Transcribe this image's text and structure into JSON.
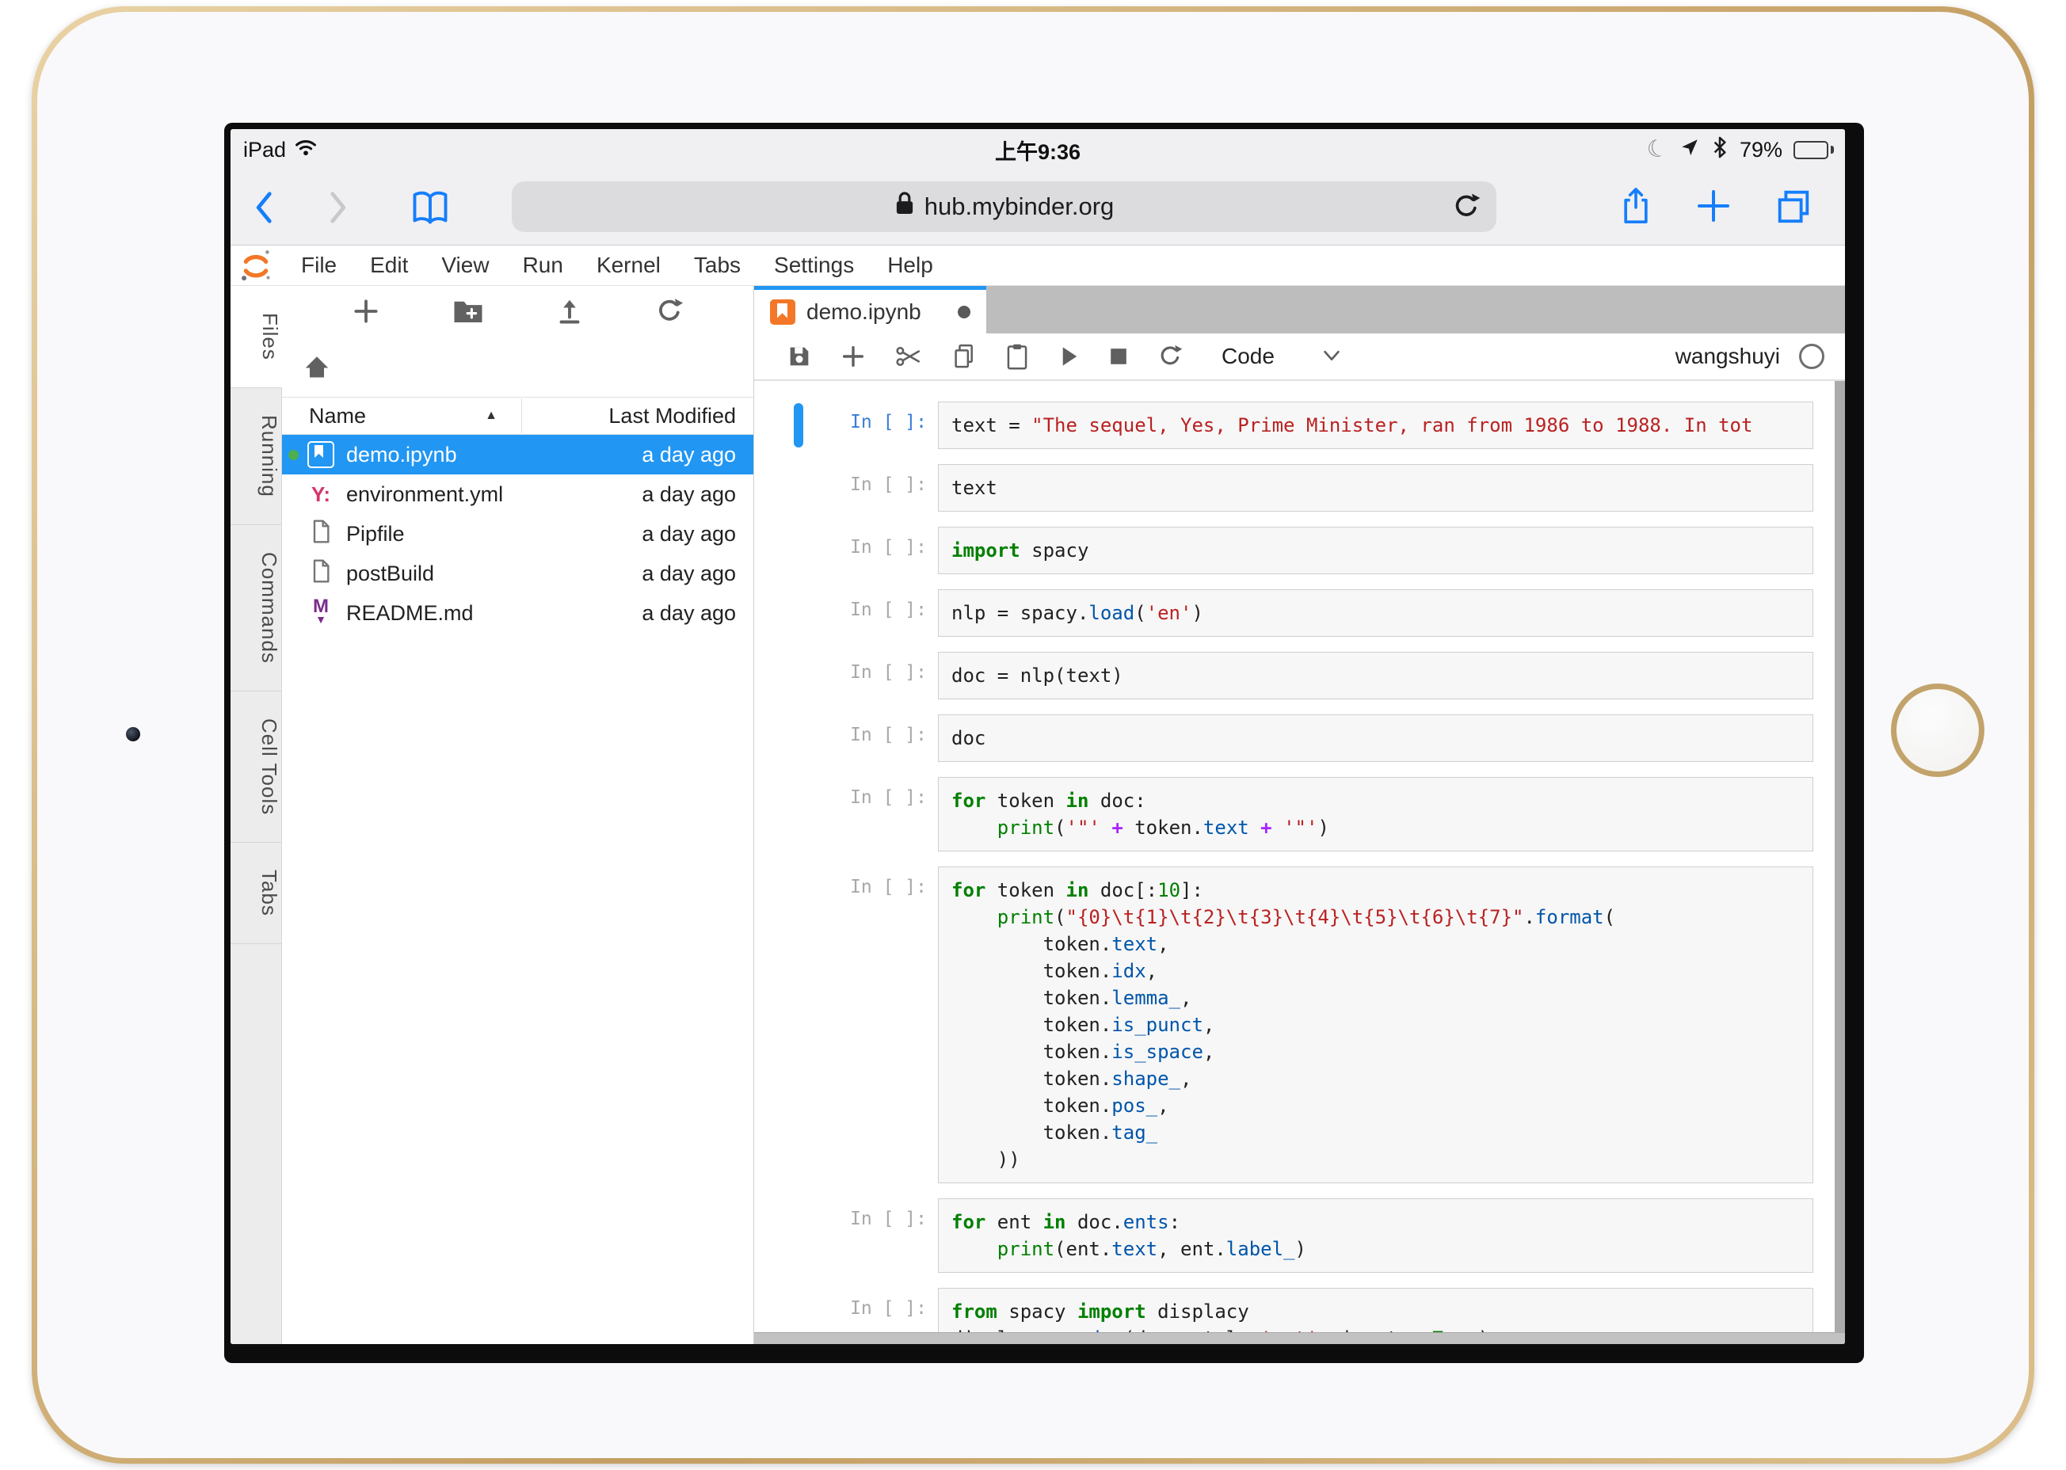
{
  "status_bar": {
    "carrier": "iPad",
    "time": "上午9:36",
    "battery_percent": "79%"
  },
  "browser": {
    "url": "hub.mybinder.org"
  },
  "menu_bar": {
    "items": [
      "File",
      "Edit",
      "View",
      "Run",
      "Kernel",
      "Tabs",
      "Settings",
      "Help"
    ]
  },
  "sidebar": {
    "tabs": [
      "Files",
      "Running",
      "Commands",
      "Cell Tools",
      "Tabs"
    ],
    "active": "Files"
  },
  "file_browser": {
    "columns": {
      "name": "Name",
      "modified": "Last Modified"
    },
    "files": [
      {
        "name": "demo.ipynb",
        "modified": "a day ago",
        "icon": "notebook-icon",
        "selected": true,
        "running": true
      },
      {
        "name": "environment.yml",
        "modified": "a day ago",
        "icon": "yaml-icon",
        "selected": false,
        "running": false
      },
      {
        "name": "Pipfile",
        "modified": "a day ago",
        "icon": "file-icon",
        "selected": false,
        "running": false
      },
      {
        "name": "postBuild",
        "modified": "a day ago",
        "icon": "file-icon",
        "selected": false,
        "running": false
      },
      {
        "name": "README.md",
        "modified": "a day ago",
        "icon": "markdown-icon",
        "selected": false,
        "running": false
      }
    ]
  },
  "notebook": {
    "tab_title": "demo.ipynb",
    "dirty": true,
    "cell_type": "Code",
    "user": "wangshuyi",
    "cells": [
      {
        "prompt": "In [ ]:",
        "active": true,
        "lines": [
          [
            [
              "t",
              "text = "
            ],
            [
              "s",
              "\"The sequel, Yes, Prime Minister, ran from 1986 to 1988. In tot"
            ]
          ]
        ]
      },
      {
        "prompt": "In [ ]:",
        "active": false,
        "lines": [
          [
            [
              "t",
              "text"
            ]
          ]
        ]
      },
      {
        "prompt": "In [ ]:",
        "active": false,
        "lines": [
          [
            [
              "k",
              "import"
            ],
            [
              "t",
              " spacy"
            ]
          ]
        ]
      },
      {
        "prompt": "In [ ]:",
        "active": false,
        "lines": [
          [
            [
              "t",
              "nlp = spacy."
            ],
            [
              "p",
              "load"
            ],
            [
              "t",
              "("
            ],
            [
              "s",
              "'en'"
            ],
            [
              "t",
              ")"
            ]
          ]
        ]
      },
      {
        "prompt": "In [ ]:",
        "active": false,
        "lines": [
          [
            [
              "t",
              "doc = nlp(text)"
            ]
          ]
        ]
      },
      {
        "prompt": "In [ ]:",
        "active": false,
        "lines": [
          [
            [
              "t",
              "doc"
            ]
          ]
        ]
      },
      {
        "prompt": "In [ ]:",
        "active": false,
        "lines": [
          [
            [
              "k",
              "for"
            ],
            [
              "t",
              " token "
            ],
            [
              "k",
              "in"
            ],
            [
              "t",
              " doc:"
            ]
          ],
          [
            [
              "t",
              "    "
            ],
            [
              "b",
              "print"
            ],
            [
              "t",
              "("
            ],
            [
              "s",
              "'\"'"
            ],
            [
              "t",
              " "
            ],
            [
              "op",
              "+"
            ],
            [
              "t",
              " token."
            ],
            [
              "p",
              "text"
            ],
            [
              "t",
              " "
            ],
            [
              "op",
              "+"
            ],
            [
              "t",
              " "
            ],
            [
              "s",
              "'\"'"
            ],
            [
              "t",
              ")"
            ]
          ]
        ]
      },
      {
        "prompt": "In [ ]:",
        "active": false,
        "lines": [
          [
            [
              "k",
              "for"
            ],
            [
              "t",
              " token "
            ],
            [
              "k",
              "in"
            ],
            [
              "t",
              " doc[:"
            ],
            [
              "n",
              "10"
            ],
            [
              "t",
              "]:"
            ]
          ],
          [
            [
              "t",
              "    "
            ],
            [
              "b",
              "print"
            ],
            [
              "t",
              "("
            ],
            [
              "s",
              "\"{0}\\t{1}\\t{2}\\t{3}\\t{4}\\t{5}\\t{6}\\t{7}\""
            ],
            [
              "t",
              "."
            ],
            [
              "p",
              "format"
            ],
            [
              "t",
              "("
            ]
          ],
          [
            [
              "t",
              "        token."
            ],
            [
              "p",
              "text"
            ],
            [
              "t",
              ","
            ]
          ],
          [
            [
              "t",
              "        token."
            ],
            [
              "p",
              "idx"
            ],
            [
              "t",
              ","
            ]
          ],
          [
            [
              "t",
              "        token."
            ],
            [
              "p",
              "lemma_"
            ],
            [
              "t",
              ","
            ]
          ],
          [
            [
              "t",
              "        token."
            ],
            [
              "p",
              "is_punct"
            ],
            [
              "t",
              ","
            ]
          ],
          [
            [
              "t",
              "        token."
            ],
            [
              "p",
              "is_space"
            ],
            [
              "t",
              ","
            ]
          ],
          [
            [
              "t",
              "        token."
            ],
            [
              "p",
              "shape_"
            ],
            [
              "t",
              ","
            ]
          ],
          [
            [
              "t",
              "        token."
            ],
            [
              "p",
              "pos_"
            ],
            [
              "t",
              ","
            ]
          ],
          [
            [
              "t",
              "        token."
            ],
            [
              "p",
              "tag_"
            ]
          ],
          [
            [
              "t",
              "    ))"
            ]
          ]
        ]
      },
      {
        "prompt": "In [ ]:",
        "active": false,
        "lines": [
          [
            [
              "k",
              "for"
            ],
            [
              "t",
              " ent "
            ],
            [
              "k",
              "in"
            ],
            [
              "t",
              " doc."
            ],
            [
              "p",
              "ents"
            ],
            [
              "t",
              ":"
            ]
          ],
          [
            [
              "t",
              "    "
            ],
            [
              "b",
              "print"
            ],
            [
              "t",
              "(ent."
            ],
            [
              "p",
              "text"
            ],
            [
              "t",
              ", ent."
            ],
            [
              "p",
              "label_"
            ],
            [
              "t",
              ")"
            ]
          ]
        ]
      },
      {
        "prompt": "In [ ]:",
        "active": false,
        "lines": [
          [
            [
              "k",
              "from"
            ],
            [
              "t",
              " spacy "
            ],
            [
              "k",
              "import"
            ],
            [
              "t",
              " displacy"
            ]
          ],
          [
            [
              "t",
              "displacy."
            ],
            [
              "p",
              "render"
            ],
            [
              "t",
              "(doc, style="
            ],
            [
              "s",
              "'ent'"
            ],
            [
              "t",
              ", jupyter="
            ],
            [
              "k",
              "True"
            ],
            [
              "t",
              ")"
            ]
          ]
        ]
      }
    ]
  },
  "colors": {
    "selection_blue": "#2196f3",
    "jupyter_orange": "#f37726",
    "safari_blue": "#157efb",
    "keyword_green": "#008000",
    "string_red": "#ba2121",
    "property_blue": "#0055aa",
    "operator_purple": "#aa22ff"
  }
}
